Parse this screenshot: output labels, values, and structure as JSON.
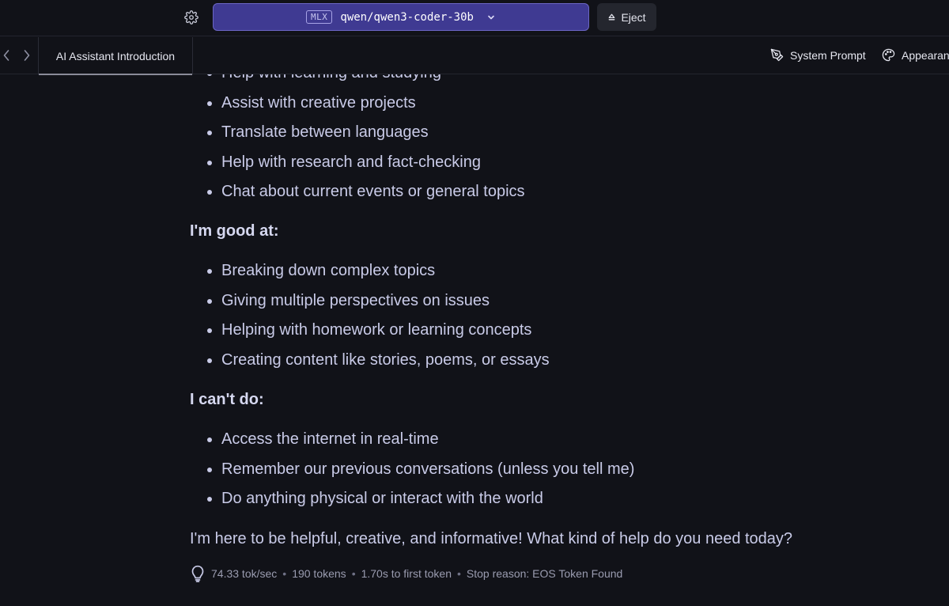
{
  "toolbar": {
    "settings_icon": "gear-icon",
    "model_badge": "MLX",
    "model_name": "qwen/qwen3-coder-30b",
    "eject_label": "Eject",
    "accent_color": "#3f3a92"
  },
  "tabbar": {
    "active_tab": "AI Assistant Introduction",
    "system_prompt_label": "System Prompt",
    "appearance_label": "Appearan"
  },
  "message": {
    "partial_top_item": "Help with learning and studying",
    "capabilities": [
      "Assist with creative projects",
      "Translate between languages",
      "Help with research and fact-checking",
      "Chat about current events or general topics"
    ],
    "good_at_heading": "I'm good at:",
    "good_at": [
      "Breaking down complex topics",
      "Giving multiple perspectives on issues",
      "Helping with homework or learning concepts",
      "Creating content like stories, poems, or essays"
    ],
    "cant_do_heading": "I can't do:",
    "cant_do": [
      "Access the internet in real-time",
      "Remember our previous conversations (unless you tell me)",
      "Do anything physical or interact with the world"
    ],
    "closing": "I'm here to be helpful, creative, and informative! What kind of help do you need today?"
  },
  "stats": {
    "speed": "74.33 tok/sec",
    "tokens": "190 tokens",
    "first_token": "1.70s to first token",
    "stop_reason": "Stop reason: EOS Token Found"
  }
}
